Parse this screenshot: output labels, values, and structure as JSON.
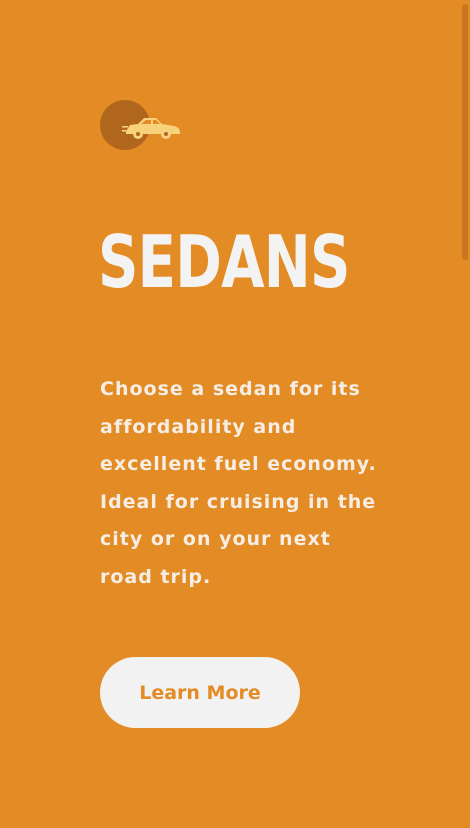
{
  "hero": {
    "icon": "sedan-car-icon",
    "title": "SEDANS",
    "description": "Choose a sedan for its affordability and excellent fuel economy. Ideal for cruising in the city or on your next road trip.",
    "cta_label": "Learn More"
  },
  "colors": {
    "background": "#E38B25",
    "icon_circle": "#B0661C",
    "icon_car": "#F7D27A",
    "text": "#F3F3F3",
    "button_bg": "#F3F2F2",
    "button_text": "#E38B25"
  }
}
